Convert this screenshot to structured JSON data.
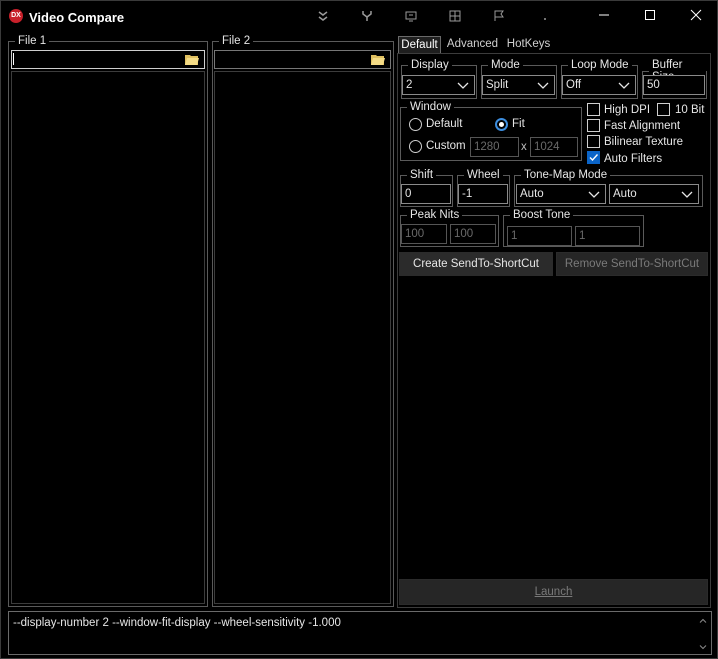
{
  "window": {
    "title": "Video Compare",
    "icon_text": "DX"
  },
  "toolbar": {
    "icons": [
      "chevrons-down-icon",
      "fork-icon",
      "monitor-arrow-icon",
      "grid-icon",
      "flag-icon",
      "dot-icon"
    ]
  },
  "file1": {
    "label": "File 1",
    "value": ""
  },
  "file2": {
    "label": "File 2",
    "value": ""
  },
  "tabs": [
    "Default",
    "Advanced",
    "HotKeys"
  ],
  "display": {
    "label": "Display",
    "value": "2"
  },
  "mode": {
    "label": "Mode",
    "value": "Split"
  },
  "loop": {
    "label": "Loop Mode",
    "value": "Off"
  },
  "buffer": {
    "label": "Buffer Size",
    "value": "50"
  },
  "window_group": {
    "label": "Window",
    "default_label": "Default",
    "fit_label": "Fit",
    "custom_label": "Custom",
    "width": "1280",
    "x_label": "x",
    "height": "1024",
    "selected": "Fit"
  },
  "options": {
    "high_dpi": {
      "label": "High DPI",
      "checked": false
    },
    "ten_bit": {
      "label": "10 Bit",
      "checked": false
    },
    "fast_alignment": {
      "label": "Fast Alignment",
      "checked": false
    },
    "bilinear": {
      "label": "Bilinear Texture",
      "checked": false
    },
    "auto_filters": {
      "label": "Auto Filters",
      "checked": true
    }
  },
  "shift": {
    "label": "Shift",
    "value": "0"
  },
  "wheel": {
    "label": "Wheel",
    "value": "-1"
  },
  "tonemap": {
    "label": "Tone-Map Mode",
    "value1": "Auto",
    "value2": "Auto"
  },
  "peak_nits": {
    "label": "Peak Nits",
    "value1": "100",
    "value2": "100"
  },
  "boost_tone": {
    "label": "Boost Tone",
    "value1": "1",
    "value2": "1"
  },
  "buttons": {
    "create": "Create SendTo-ShortCut",
    "remove": "Remove SendTo-ShortCut",
    "launch": "Launch"
  },
  "command_line": "--display-number 2 --window-fit-display --wheel-sensitivity -1.000",
  "colors": {
    "accent": "#0a64c8",
    "background": "#000000",
    "button": "#2b2b2b"
  }
}
